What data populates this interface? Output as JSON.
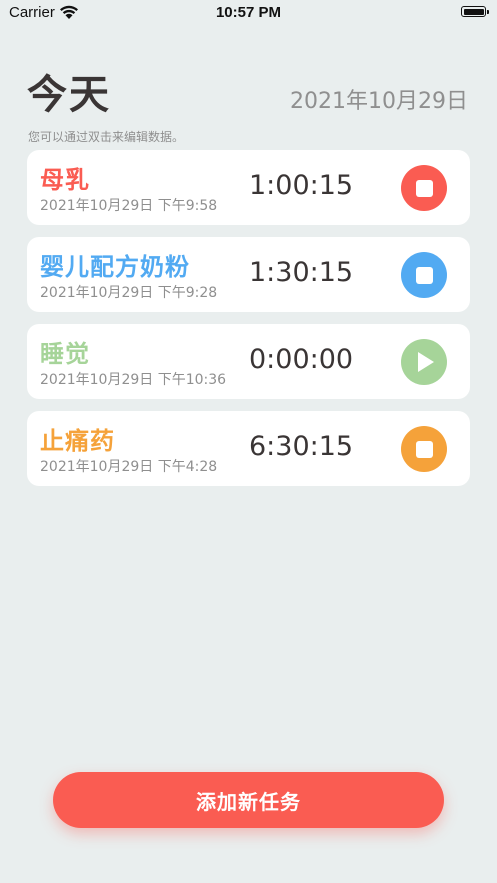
{
  "status_bar": {
    "carrier": "Carrier",
    "time": "10:57 PM"
  },
  "header": {
    "title": "今天",
    "date": "2021年10月29日"
  },
  "hint": "您可以通过双击来编辑数据。",
  "tasks": [
    {
      "name": "母乳",
      "start": "2021年10月29日 下午9:58",
      "elapsed": "1:00:15",
      "color": "#fa5c52",
      "state": "running",
      "button_icon": "stop-icon"
    },
    {
      "name": "婴儿配方奶粉",
      "start": "2021年10月29日 下午9:28",
      "elapsed": "1:30:15",
      "color": "#52aaf2",
      "state": "running",
      "button_icon": "stop-icon"
    },
    {
      "name": "睡觉",
      "start": "2021年10月29日 下午10:36",
      "elapsed": "0:00:00",
      "color": "#a6d499",
      "state": "stopped",
      "button_icon": "play-icon"
    },
    {
      "name": "止痛药",
      "start": "2021年10月29日 下午4:28",
      "elapsed": "6:30:15",
      "color": "#f5a23a",
      "state": "running",
      "button_icon": "stop-icon"
    }
  ],
  "add_button": {
    "label": "添加新任务",
    "color": "#fa5c52"
  }
}
